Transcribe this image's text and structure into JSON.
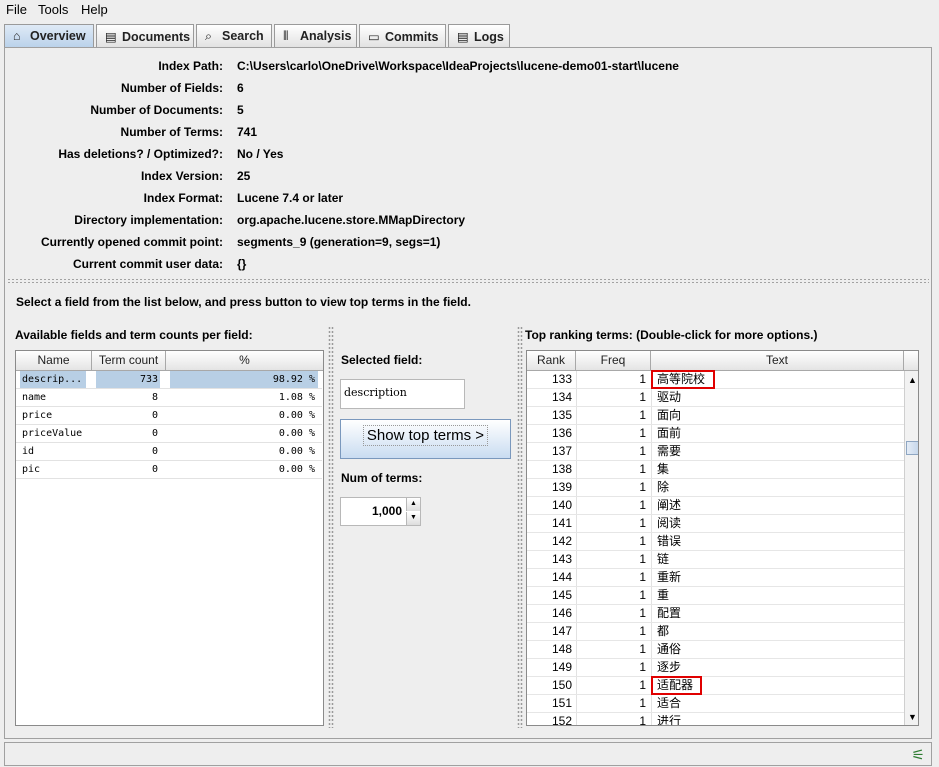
{
  "menu": [
    "File",
    "Tools",
    "Help"
  ],
  "tabs": [
    {
      "label": "Overview",
      "icon": "home-icon",
      "glyph": "⌂",
      "active": true
    },
    {
      "label": "Documents",
      "icon": "documents-icon",
      "glyph": "▤",
      "active": false
    },
    {
      "label": "Search",
      "icon": "search-icon",
      "glyph": "⌕",
      "active": false
    },
    {
      "label": "Analysis",
      "icon": "analysis-icon",
      "glyph": "⦀",
      "active": false
    },
    {
      "label": "Commits",
      "icon": "commits-icon",
      "glyph": "▭",
      "active": false
    },
    {
      "label": "Logs",
      "icon": "logs-icon",
      "glyph": "▤",
      "active": false
    }
  ],
  "overview": [
    {
      "label": "Index Path:",
      "value": "C:\\Users\\carlo\\OneDrive\\Workspace\\IdeaProjects\\lucene-demo01-start\\lucene"
    },
    {
      "label": "Number of Fields:",
      "value": "6"
    },
    {
      "label": "Number of Documents:",
      "value": "5"
    },
    {
      "label": "Number of Terms:",
      "value": "741"
    },
    {
      "label": "Has deletions? / Optimized?:",
      "value": "No / Yes"
    },
    {
      "label": "Index Version:",
      "value": "25"
    },
    {
      "label": "Index Format:",
      "value": "Lucene 7.4 or later"
    },
    {
      "label": "Directory implementation:",
      "value": "org.apache.lucene.store.MMapDirectory"
    },
    {
      "label": "Currently opened commit point:",
      "value": "segments_9 (generation=9, segs=1)"
    },
    {
      "label": "Current commit user data:",
      "value": "{}"
    }
  ],
  "hint": "Select a field from the list below, and press button to view top terms in the field.",
  "fields_panel": {
    "title": "Available fields and term counts per field:",
    "headers": [
      "Name",
      "Term count",
      "%"
    ],
    "rows": [
      {
        "name": "descrip...",
        "count": "733",
        "pct": "98.92 %",
        "selected": true
      },
      {
        "name": "name",
        "count": "8",
        "pct": "1.08 %",
        "selected": false
      },
      {
        "name": "price",
        "count": "0",
        "pct": "0.00 %",
        "selected": false
      },
      {
        "name": "priceValue",
        "count": "0",
        "pct": "0.00 %",
        "selected": false
      },
      {
        "name": "id",
        "count": "0",
        "pct": "0.00 %",
        "selected": false
      },
      {
        "name": "pic",
        "count": "0",
        "pct": "0.00 %",
        "selected": false
      }
    ]
  },
  "middle": {
    "selected_label": "Selected field:",
    "selected_value": "description",
    "button_label": "Show top terms >",
    "num_label": "Num of terms:",
    "num_value": "1,000"
  },
  "terms_panel": {
    "title": "Top ranking terms: (Double-click for more options.)",
    "headers": [
      "Rank",
      "Freq",
      "Text"
    ],
    "rows": [
      {
        "rank": "133",
        "freq": "1",
        "text": "高等院校",
        "highlight": true
      },
      {
        "rank": "134",
        "freq": "1",
        "text": "驱动"
      },
      {
        "rank": "135",
        "freq": "1",
        "text": "面向"
      },
      {
        "rank": "136",
        "freq": "1",
        "text": "面前"
      },
      {
        "rank": "137",
        "freq": "1",
        "text": "需要"
      },
      {
        "rank": "138",
        "freq": "1",
        "text": "集"
      },
      {
        "rank": "139",
        "freq": "1",
        "text": "除"
      },
      {
        "rank": "140",
        "freq": "1",
        "text": "阐述"
      },
      {
        "rank": "141",
        "freq": "1",
        "text": "阅读"
      },
      {
        "rank": "142",
        "freq": "1",
        "text": "错误"
      },
      {
        "rank": "143",
        "freq": "1",
        "text": "链"
      },
      {
        "rank": "144",
        "freq": "1",
        "text": "重新"
      },
      {
        "rank": "145",
        "freq": "1",
        "text": "重"
      },
      {
        "rank": "146",
        "freq": "1",
        "text": "配置"
      },
      {
        "rank": "147",
        "freq": "1",
        "text": "都"
      },
      {
        "rank": "148",
        "freq": "1",
        "text": "通俗"
      },
      {
        "rank": "149",
        "freq": "1",
        "text": "逐步"
      },
      {
        "rank": "150",
        "freq": "1",
        "text": "适配器",
        "highlight": true
      },
      {
        "rank": "151",
        "freq": "1",
        "text": "适合"
      },
      {
        "rank": "152",
        "freq": "1",
        "text": "进行"
      }
    ]
  },
  "colors": {
    "selection": "#b8cfe5",
    "highlight_box": "#e00000",
    "status_icon": "#2e7d32"
  }
}
